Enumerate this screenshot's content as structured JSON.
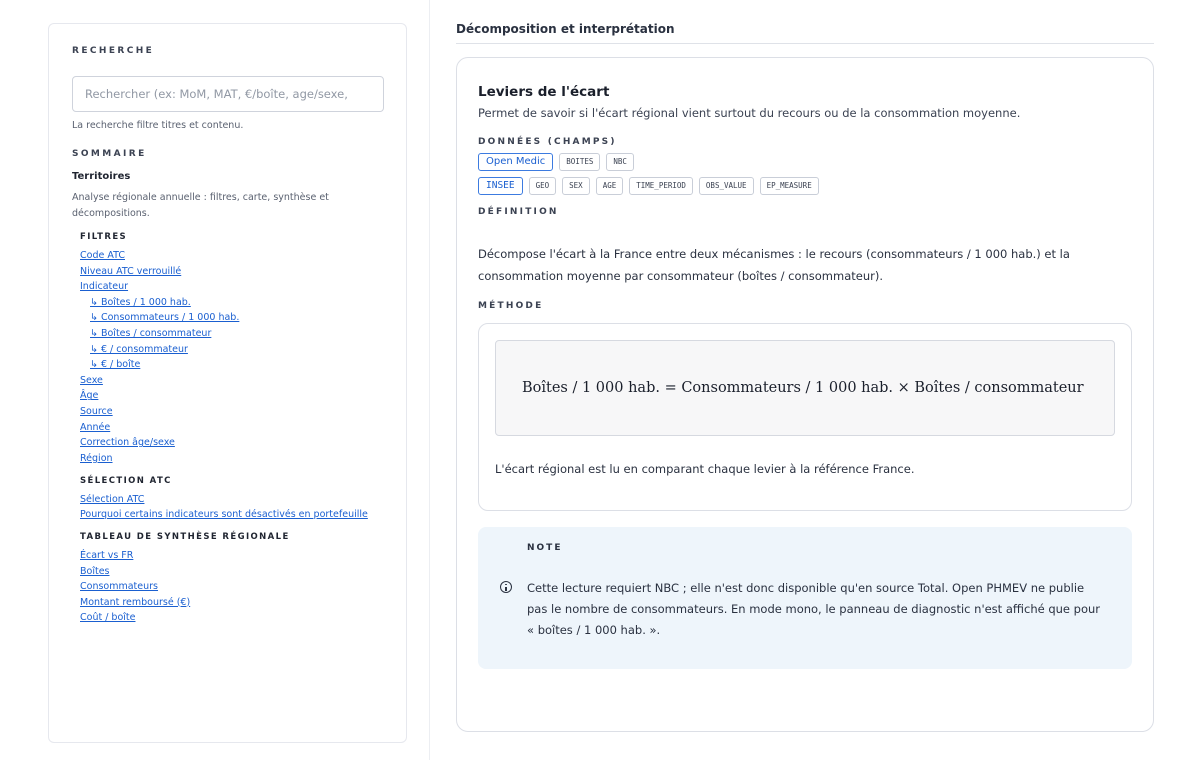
{
  "sidebar": {
    "search_label": "RECHERCHE",
    "search_placeholder": "Rechercher (ex: MoM, MAT, €/boîte, age/sexe,",
    "search_hint": "La recherche filtre titres et contenu.",
    "sommaire_label": "SOMMAIRE",
    "section_title": "Territoires",
    "section_desc": "Analyse régionale annuelle : filtres, carte, synthèse et décompositions.",
    "groups": [
      {
        "title": "FILTRES",
        "links": [
          {
            "label": "Code ATC",
            "sub": false
          },
          {
            "label": "Niveau ATC verrouillé",
            "sub": false
          },
          {
            "label": "Indicateur",
            "sub": false
          },
          {
            "label": "↳ Boîtes / 1 000 hab.",
            "sub": true
          },
          {
            "label": "↳ Consommateurs / 1 000 hab.",
            "sub": true
          },
          {
            "label": "↳ Boîtes / consommateur",
            "sub": true
          },
          {
            "label": "↳ € / consommateur",
            "sub": true
          },
          {
            "label": "↳ € / boîte",
            "sub": true
          },
          {
            "label": "Sexe",
            "sub": false
          },
          {
            "label": "Âge",
            "sub": false
          },
          {
            "label": "Source",
            "sub": false
          },
          {
            "label": "Année",
            "sub": false
          },
          {
            "label": "Correction âge/sexe",
            "sub": false
          },
          {
            "label": "Région",
            "sub": false
          }
        ]
      },
      {
        "title": "SÉLECTION ATC",
        "links": [
          {
            "label": "Sélection ATC",
            "sub": false
          },
          {
            "label": "Pourquoi certains indicateurs sont désactivés en portefeuille",
            "sub": false
          }
        ]
      },
      {
        "title": "TABLEAU DE SYNTHÈSE RÉGIONALE",
        "links": [
          {
            "label": "Écart vs FR",
            "sub": false
          },
          {
            "label": "Boîtes",
            "sub": false
          },
          {
            "label": "Consommateurs",
            "sub": false
          },
          {
            "label": "Montant remboursé (€)",
            "sub": false
          },
          {
            "label": "Coût / boîte",
            "sub": false
          }
        ]
      }
    ]
  },
  "main": {
    "title": "Décomposition et interprétation",
    "card": {
      "title": "Leviers de l'écart",
      "subtitle": "Permet de savoir si l'écart régional vient surtout du recours ou de la consommation moyenne.",
      "data_label": "DONNÉES (CHAMPS)",
      "rows": [
        {
          "source": "Open Medic",
          "source_mono": false,
          "fields": [
            "BOITES",
            "NBC"
          ]
        },
        {
          "source": "INSEE",
          "source_mono": true,
          "fields": [
            "GEO",
            "SEX",
            "AGE",
            "TIME_PERIOD",
            "OBS_VALUE",
            "EP_MEASURE"
          ]
        }
      ],
      "definition_label": "DÉFINITION",
      "definition_text": "Décompose l'écart à la France entre deux mécanismes : le recours (consommateurs / 1 000 hab.) et la consommation moyenne par consommateur (boîtes / consommateur).",
      "method_label": "MÉTHODE",
      "formula": "Boîtes / 1 000 hab. = Consommateurs / 1 000 hab. × Boîtes / consommateur",
      "method_footer": "L'écart régional est lu en comparant chaque levier à la référence France.",
      "note_label": "NOTE",
      "note_text": "Cette lecture requiert NBC ; elle n'est donc disponible qu'en source Total. Open PHMEV ne publie pas le nombre de consommateurs. En mode mono, le panneau de diagnostic n'est affiché que pour « boîtes / 1 000 hab. »."
    }
  }
}
